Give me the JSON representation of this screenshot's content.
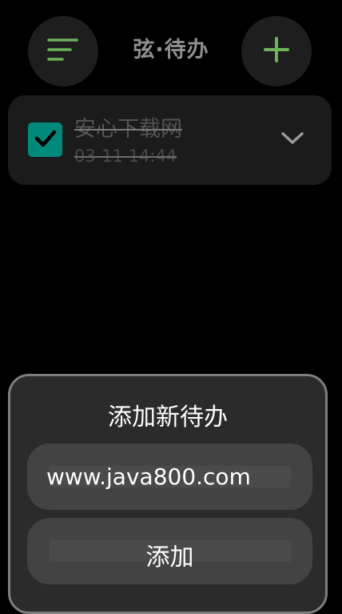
{
  "header": {
    "title": "弦·待办",
    "menu_icon": "menu-lines-icon",
    "add_icon": "plus-icon"
  },
  "todos": [
    {
      "title": "安心下载网",
      "time": "03-11 14:44",
      "completed": true
    }
  ],
  "dialog": {
    "title": "添加新待办",
    "input_value": "www.java800.com",
    "add_label": "添加"
  },
  "colors": {
    "accent_green": "#6db35a",
    "checkbox_teal": "#00897b",
    "background": "#000000"
  }
}
